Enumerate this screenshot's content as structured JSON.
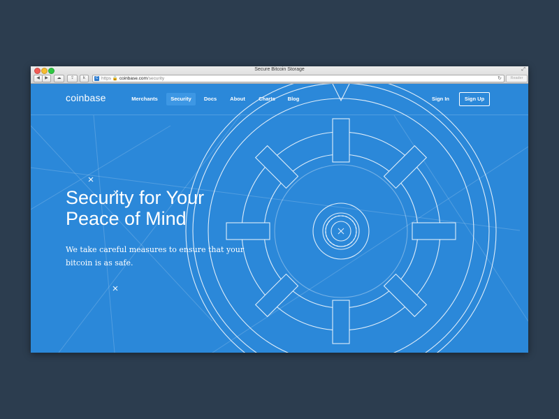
{
  "window": {
    "title": "Secure Bitcoin Storage",
    "controls": [
      "close",
      "minimize",
      "zoom"
    ],
    "toolbar": {
      "back_icon": "back-arrow-icon",
      "forward_icon": "forward-arrow-icon",
      "cloud_icon": "icloud-tabs-icon",
      "share_icon": "share-icon",
      "extension_label": "k"
    },
    "address": {
      "favicon": "C",
      "scheme": "https",
      "host": "coinbase.com",
      "path": "/security"
    },
    "reader_label": "Reader"
  },
  "site": {
    "logo": "coinbase",
    "nav": [
      {
        "label": "Merchants"
      },
      {
        "label": "Security"
      },
      {
        "label": "Docs"
      },
      {
        "label": "About"
      },
      {
        "label": "Charts"
      },
      {
        "label": "Blog"
      }
    ],
    "active_nav": "Security",
    "signin_label": "Sign In",
    "signup_label": "Sign Up"
  },
  "hero": {
    "title_line1": "Security for Your",
    "title_line2": "Peace of Mind",
    "subtitle_line1": "We take careful measures to ensure that your",
    "subtitle_line2": "bitcoin is as safe."
  },
  "colors": {
    "background": "#2c3d4f",
    "brand_blue": "#2b88d9",
    "active_nav_bg": "#3d97e4"
  }
}
